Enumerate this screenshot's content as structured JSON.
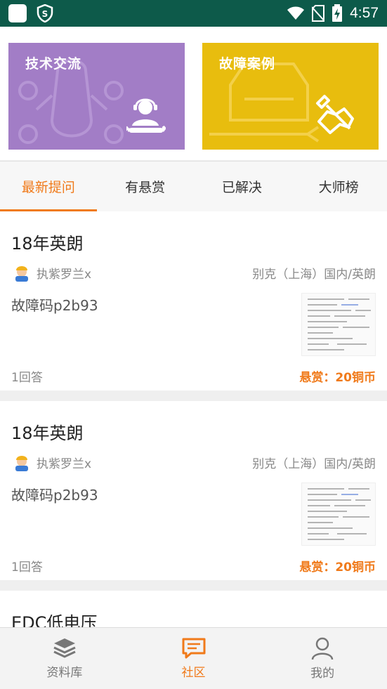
{
  "status_bar": {
    "time": "4:57"
  },
  "banners": [
    {
      "title": "技术交流"
    },
    {
      "title": "故障案例"
    }
  ],
  "tabs": [
    {
      "label": "最新提问",
      "active": true
    },
    {
      "label": "有悬赏"
    },
    {
      "label": "已解决"
    },
    {
      "label": "大师榜"
    }
  ],
  "posts": [
    {
      "title": "18年英朗",
      "user": "执紫罗兰x",
      "car": "别克（上海）国内/英朗",
      "content": "故障码p2b93",
      "answers": "1回答",
      "reward": "悬赏：20铜币"
    },
    {
      "title": "18年英朗",
      "user": "执紫罗兰x",
      "car": "别克（上海）国内/英朗",
      "content": "故障码p2b93",
      "answers": "1回答",
      "reward": "悬赏：20铜币"
    },
    {
      "title": "EDC低电压"
    }
  ],
  "bottom_nav": [
    {
      "label": "资料库",
      "icon": "layers-icon"
    },
    {
      "label": "社区",
      "icon": "chat-icon",
      "active": true
    },
    {
      "label": "我的",
      "icon": "person-icon"
    }
  ],
  "colors": {
    "accent": "#f07a1a",
    "status_bar": "#0d5a4a",
    "purple_card": "#a27dc6",
    "yellow_card": "#e8bd0e"
  }
}
